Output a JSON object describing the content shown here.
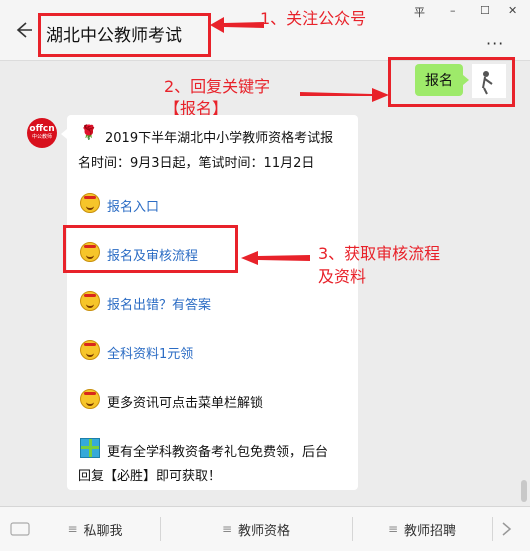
{
  "window": {
    "pin_glyph": "平",
    "minimize_glyph": "–",
    "maximize_glyph": "☐",
    "close_glyph": "✕"
  },
  "header": {
    "title": "湖北中公教师考试",
    "more_glyph": "···"
  },
  "annotations": {
    "step1": "1、关注公众号",
    "step2_line1": "2、回复关键字",
    "step2_line2": "【报名】",
    "step3_line1": "3、获取审核流程",
    "step3_line2": "及资料"
  },
  "user_message": {
    "text": "报名"
  },
  "bot": {
    "avatar_top": "offcn",
    "avatar_bottom": "中公教师",
    "flower_glyph": "🌹",
    "headline": "2019下半年湖北中小学教师资格考试报",
    "dates": "名时间：9月3日起，笔试时间：11月2日",
    "links": [
      "报名入口",
      "报名及审核流程",
      "报名出错？有答案",
      "全科资料1元领"
    ],
    "unlock_text": "更多资讯可点击菜单栏解锁",
    "gift_line1": "更有全学科教资备考礼包免费领，后台",
    "gift_line2": "回复【必胜】即可获取！"
  },
  "bottom_menu": {
    "bars_glyph": "≡",
    "items": [
      "私聊我",
      "教师资格",
      "教师招聘"
    ]
  },
  "colors": {
    "annotation_red": "#e8222a",
    "link_blue": "#2b6cc4",
    "bubble_green": "#9eea6a"
  }
}
